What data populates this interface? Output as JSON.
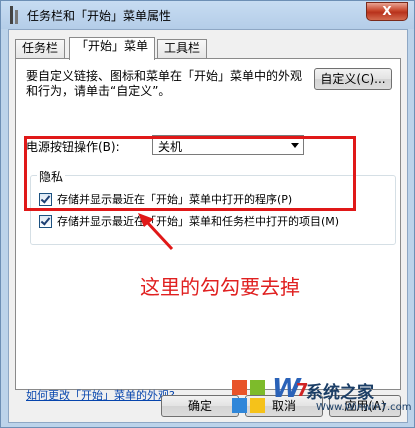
{
  "window": {
    "title": "任务栏和「开始」菜单属性",
    "close_label": "X"
  },
  "tabs": [
    {
      "label": "任务栏",
      "active": false
    },
    {
      "label": "「开始」菜单",
      "active": true
    },
    {
      "label": "工具栏",
      "active": false
    }
  ],
  "panel": {
    "description": "要自定义链接、图标和菜单在「开始」菜单中的外观和行为，请单击“自定义”。",
    "customize_button": "自定义(C)...",
    "power_label": "电源按钮操作(B):",
    "power_value": "关机",
    "privacy_title": "隐私",
    "privacy_items": [
      {
        "label": "存储并显示最近在「开始」菜单中打开的程序(P)",
        "checked": true
      },
      {
        "label": "存储并显示最近在「开始」菜单和任务栏中打开的项目(M)",
        "checked": true
      }
    ],
    "help_link": "如何更改「开始」菜单的外观?"
  },
  "annotation": {
    "text": "这里的勾勾要去掉",
    "color": "#e02020"
  },
  "footer": {
    "ok_button": "确定",
    "cancel_button": "取消",
    "apply_button": "应用(A)"
  },
  "watermark": {
    "logo_text": "W",
    "logo_num": "7",
    "name": "系统之家",
    "url": "Www.Winwin7.com"
  }
}
